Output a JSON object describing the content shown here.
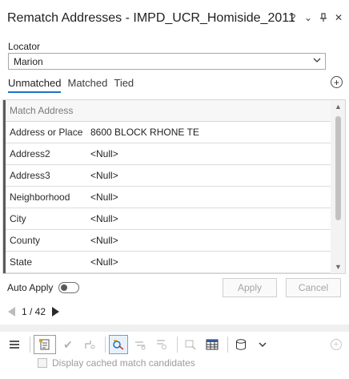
{
  "pane": {
    "title": "Rematch Addresses - IMPD_UCR_Homiside_2011",
    "title_icons": [
      "help-icon",
      "chevron-down-icon",
      "pin-icon",
      "close-icon"
    ],
    "help_glyph": "?",
    "menu_glyph": "⌄",
    "pin_glyph": "⊓",
    "close_glyph": "✕"
  },
  "locator": {
    "label": "Locator",
    "value": "Marion"
  },
  "tabs": [
    {
      "label": "Unmatched",
      "active": true
    },
    {
      "label": "Matched",
      "active": false
    },
    {
      "label": "Tied",
      "active": false
    }
  ],
  "grid": {
    "header": "Match Address",
    "rows": [
      {
        "key": "Address or Place",
        "value": "8600 BLOCK RHONE TE"
      },
      {
        "key": "Address2",
        "value": "<Null>"
      },
      {
        "key": "Address3",
        "value": "<Null>"
      },
      {
        "key": "Neighborhood",
        "value": "<Null>"
      },
      {
        "key": "City",
        "value": "<Null>"
      },
      {
        "key": "County",
        "value": "<Null>"
      },
      {
        "key": "State",
        "value": "<Null>"
      }
    ]
  },
  "controls": {
    "auto_apply_label": "Auto Apply",
    "auto_apply_on": false,
    "apply_label": "Apply",
    "cancel_label": "Cancel"
  },
  "pager": {
    "text": "1 / 42"
  },
  "options": {
    "display_cached_label": "Display cached match candidates",
    "display_cached_checked": false
  },
  "colors": {
    "accent": "#1f6fc5",
    "disabled_text": "#a5a5a5"
  }
}
